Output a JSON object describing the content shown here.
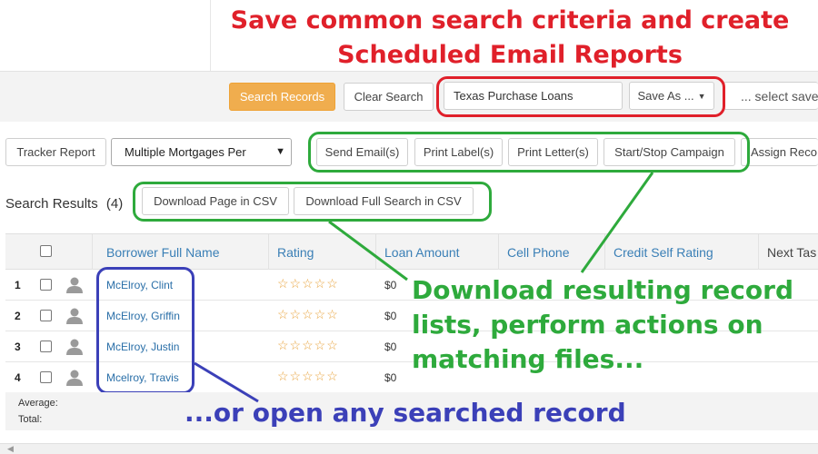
{
  "headline": {
    "line1": "Save common search criteria and create",
    "line2": "Scheduled Email Reports"
  },
  "search_toolbar": {
    "search_button": "Search Records",
    "clear_button": "Clear Search",
    "saved_name_value": "Texas Purchase Loans",
    "save_as_button": "Save As ...",
    "saved_select_placeholder": "... select saved"
  },
  "action_bar": {
    "tracker_button": "Tracker Report",
    "report_select_value": "Multiple Mortgages Per",
    "send_email": "Send Email(s)",
    "print_labels": "Print Label(s)",
    "print_letters": "Print Letter(s)",
    "campaign": "Start/Stop Campaign",
    "assign": "Assign Reco"
  },
  "results": {
    "title": "Search Results",
    "count": "(4)",
    "download_page_csv": "Download Page in CSV",
    "download_full_csv": "Download Full Search in CSV"
  },
  "table": {
    "columns": [
      "Borrower Full Name",
      "Rating",
      "Loan Amount",
      "Cell Phone",
      "Credit Self Rating",
      "Next Tas"
    ],
    "rows": [
      {
        "num": "1",
        "name": "McElroy, Clint",
        "rating": "☆☆☆☆☆",
        "amount": "$0"
      },
      {
        "num": "2",
        "name": "McElroy, Griffin",
        "rating": "☆☆☆☆☆",
        "amount": "$0"
      },
      {
        "num": "3",
        "name": "McElroy, Justin",
        "rating": "☆☆☆☆☆",
        "amount": "$0"
      },
      {
        "num": "4",
        "name": "Mcelroy, Travis",
        "rating": "☆☆☆☆☆",
        "amount": "$0"
      }
    ],
    "average_label": "Average:",
    "total_label": "Total:"
  },
  "callouts": {
    "green_line1": "Download resulting record",
    "green_line2": "lists, perform actions on",
    "green_line3": "matching files...",
    "blue": "...or open any searched record"
  },
  "colors": {
    "red": "#e0202a",
    "green": "#2eaa3c",
    "blue": "#3b40b8",
    "orange_button": "#f0ad4e",
    "link_blue": "#3a7fb6"
  },
  "icons": {
    "avatar": "person-icon",
    "dropdown": "chevron-down-icon"
  }
}
